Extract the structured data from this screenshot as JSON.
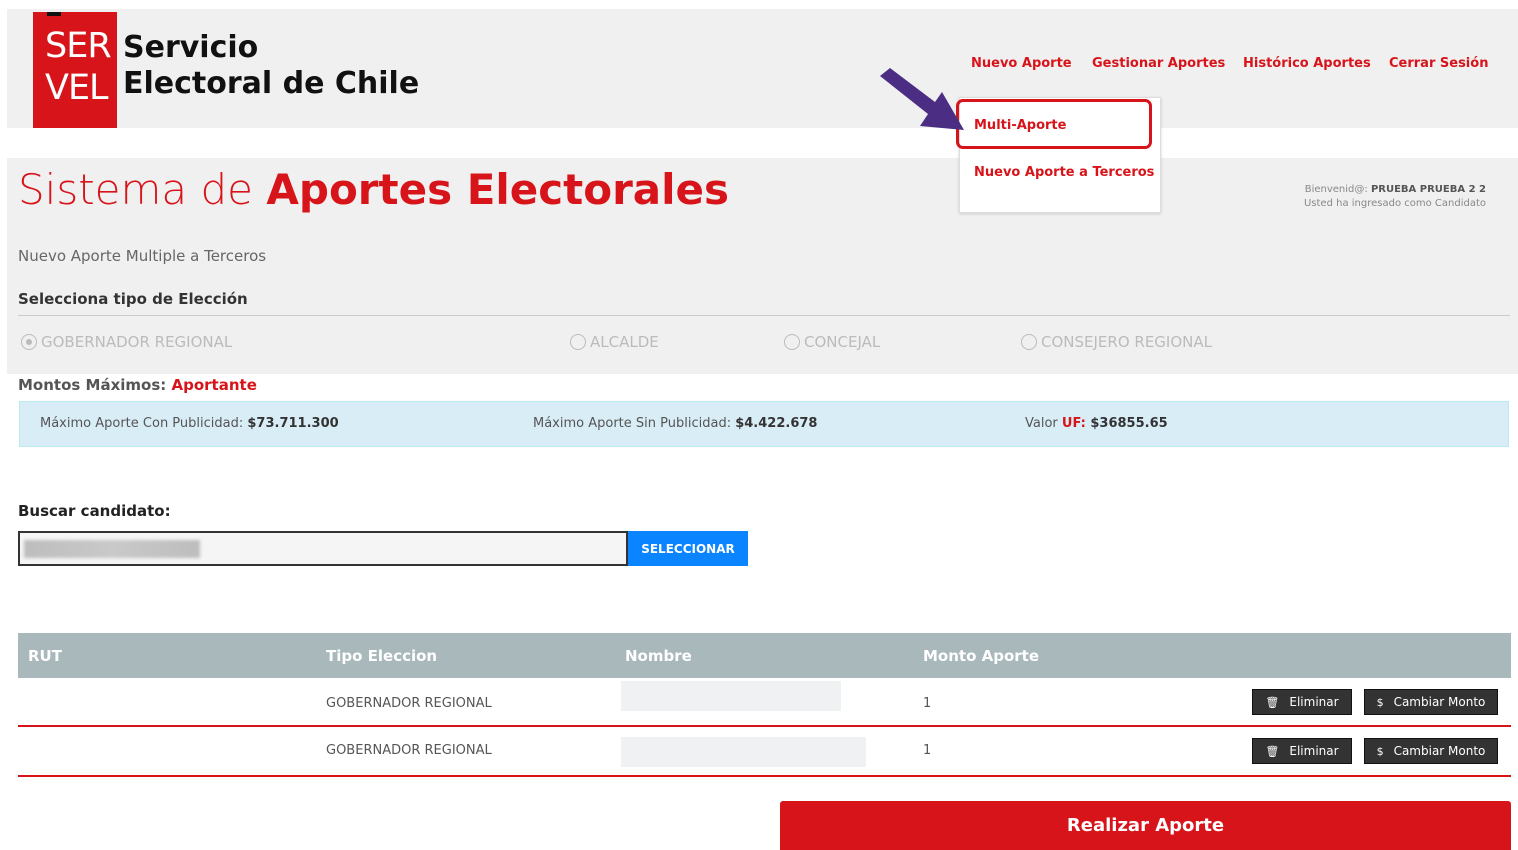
{
  "header": {
    "logo": {
      "line1": "SER",
      "line2": "VEL"
    },
    "org_name_line1": "Servicio",
    "org_name_line2": "Electoral de Chile",
    "nav": [
      {
        "label": "Nuevo Aporte"
      },
      {
        "label": "Gestionar Aportes"
      },
      {
        "label": "Histórico Aportes"
      },
      {
        "label": "Cerrar Sesión"
      }
    ],
    "dropdown": [
      {
        "label": "Multi-Aporte"
      },
      {
        "label": "Nuevo Aporte a Terceros"
      }
    ]
  },
  "page": {
    "title_light": "Sistema de ",
    "title_bold": "Aportes Electorales",
    "welcome_prefix": "Bienvenid@: ",
    "welcome_user": "PRUEBA PRUEBA 2 2",
    "welcome_role": "Usted ha ingresado como Candidato",
    "subtitle": "Nuevo Aporte Multiple a Terceros",
    "election_label": "Selecciona tipo de Elección",
    "election_options": [
      {
        "label": "GOBERNADOR REGIONAL",
        "selected": true
      },
      {
        "label": "ALCALDE",
        "selected": false
      },
      {
        "label": "CONCEJAL",
        "selected": false
      },
      {
        "label": "CONSEJERO REGIONAL",
        "selected": false
      }
    ]
  },
  "montos": {
    "label": "Montos Máximos: ",
    "role": "Aportante",
    "con_publicidad_label": "Máximo Aporte Con Publicidad: ",
    "con_publicidad_value": "$73.711.300",
    "sin_publicidad_label": "Máximo Aporte Sin Publicidad: ",
    "sin_publicidad_value": "$4.422.678",
    "valor_label": "Valor ",
    "uf_label": "UF:",
    "uf_value": " $36855.65"
  },
  "search": {
    "label": "Buscar candidato:",
    "button": "SELECCIONAR"
  },
  "table": {
    "headers": [
      "RUT",
      "Tipo Eleccion",
      "Nombre",
      "Monto Aporte"
    ],
    "rows": [
      {
        "rut": "",
        "tipo": "GOBERNADOR REGIONAL",
        "nombre": "",
        "monto": "1"
      },
      {
        "rut": "",
        "tipo": "GOBERNADOR REGIONAL",
        "nombre": "",
        "monto": "1"
      }
    ],
    "delete_label": "Eliminar",
    "change_label": "Cambiar Monto"
  },
  "submit_label": "Realizar Aporte",
  "colors": {
    "brand_red": "#d7141a",
    "arrow_purple": "#4b2e83",
    "select_blue": "#0a84ff"
  },
  "icons": [
    "trash-icon",
    "dollar-icon",
    "arrow-pointer-icon",
    "radio-icon"
  ]
}
